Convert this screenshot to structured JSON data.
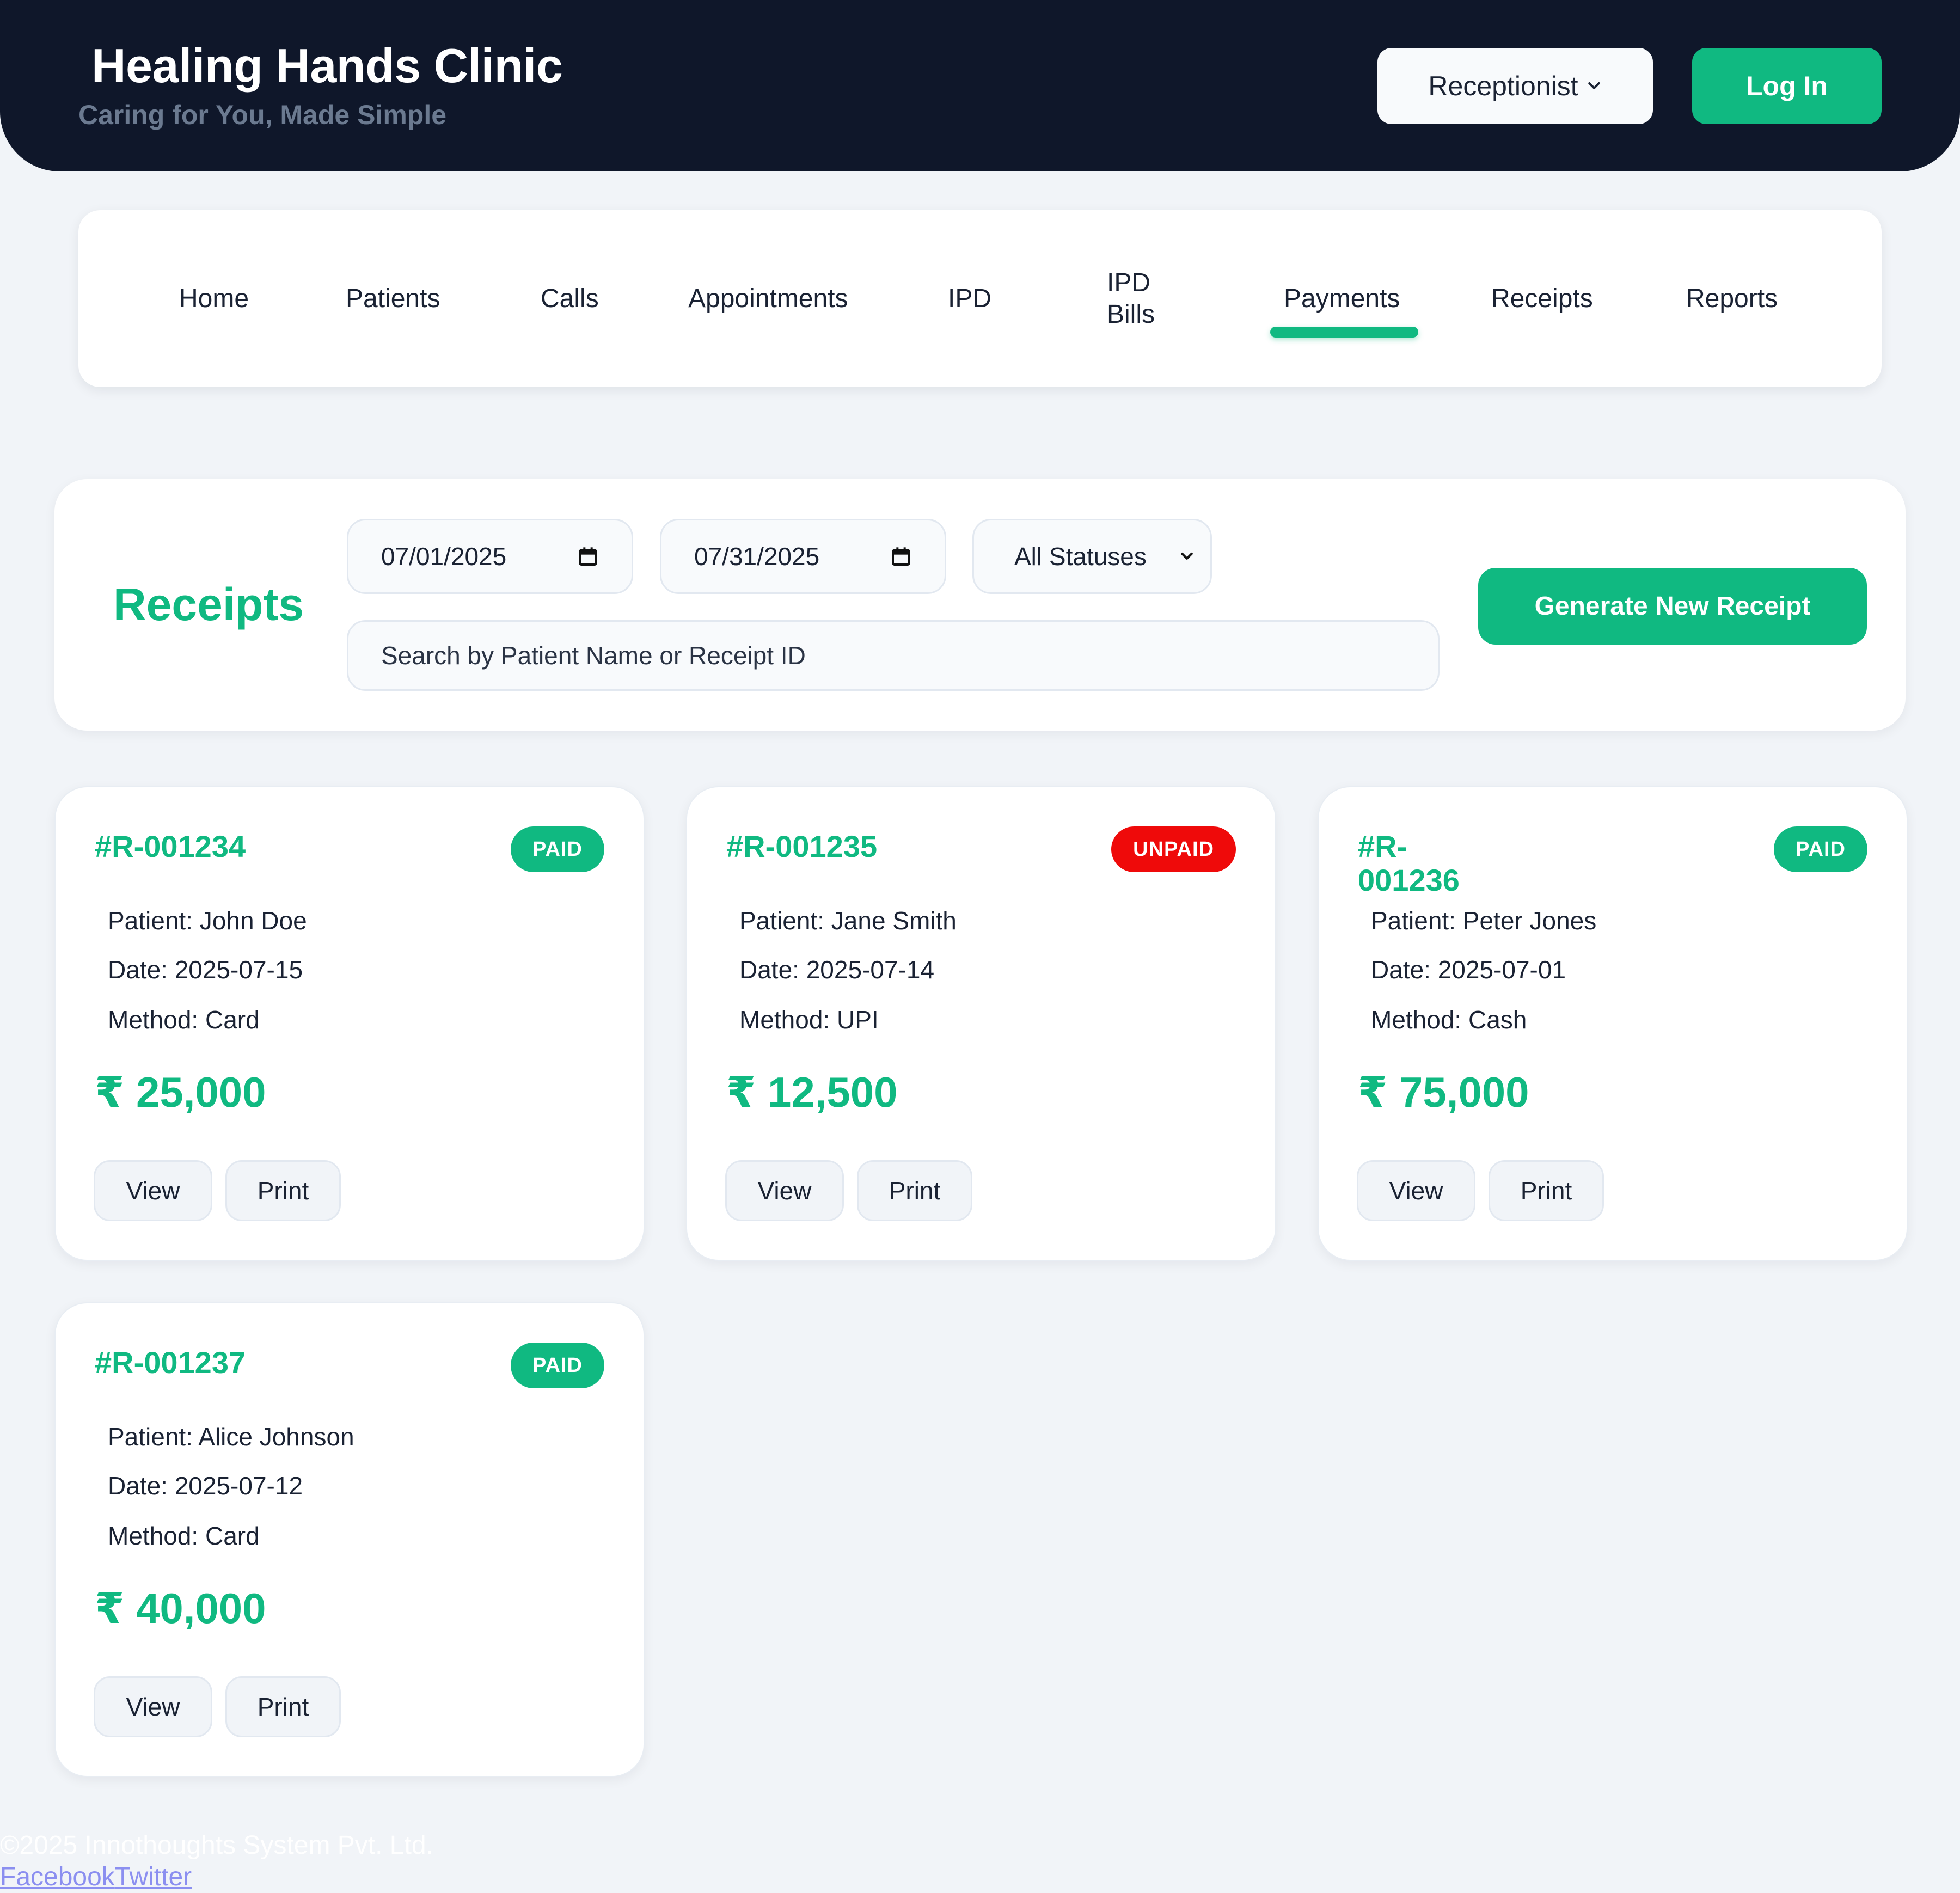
{
  "header": {
    "title": "Healing Hands Clinic",
    "tagline": "Caring for You, Made Simple",
    "role_selected": "Receptionist",
    "role_icon": "chevron-down-icon",
    "login_label": "Log In"
  },
  "nav": {
    "active": "Payments",
    "items": [
      {
        "label": "Home"
      },
      {
        "label": "Patients"
      },
      {
        "label": "Calls"
      },
      {
        "label": "Appointments"
      },
      {
        "label": "IPD"
      },
      {
        "label": "IPD Bills"
      },
      {
        "label": "Payments"
      },
      {
        "label": "Receipts"
      },
      {
        "label": "Reports"
      }
    ]
  },
  "filters": {
    "heading": "Receipts",
    "date_from": "07/01/2025",
    "date_to": "07/31/2025",
    "status_selected": "All Statuses",
    "search_placeholder": "Search by Patient Name or Receipt ID",
    "generate_label": "Generate New Receipt"
  },
  "receipts": [
    {
      "id": "#R-001234",
      "status": "PAID",
      "patient": "Patient: John Doe",
      "date": "Date: 2025-07-15",
      "method": "Method: Card",
      "amount": "₹ 25,000",
      "view_label": "View",
      "print_label": "Print"
    },
    {
      "id": "#R-001235",
      "status": "UNPAID",
      "patient": "Patient: Jane Smith",
      "date": "Date: 2025-07-14",
      "method": "Method: UPI",
      "amount": "₹ 12,500",
      "view_label": "View",
      "print_label": "Print"
    },
    {
      "id": "#R-001236",
      "status": "PAID",
      "patient": "Patient: Peter Jones",
      "date": "Date: 2025-07-01",
      "method": "Method: Cash",
      "amount": "₹ 75,000",
      "view_label": "View",
      "print_label": "Print"
    },
    {
      "id": "#R-001237",
      "status": "PAID",
      "patient": "Patient: Alice Johnson",
      "date": "Date: 2025-07-12",
      "method": "Method: Card",
      "amount": "₹ 40,000",
      "view_label": "View",
      "print_label": "Print"
    }
  ],
  "footer": {
    "copyright": "©2025 Innothoughts System Pvt. Ltd.",
    "link_facebook": "Facebook",
    "link_twitter": "Twitter"
  },
  "colors": {
    "accent": "#10b981",
    "header_bg": "#0f172a",
    "page_bg": "#f1f4f8",
    "unpaid": "#ef0a0a"
  }
}
